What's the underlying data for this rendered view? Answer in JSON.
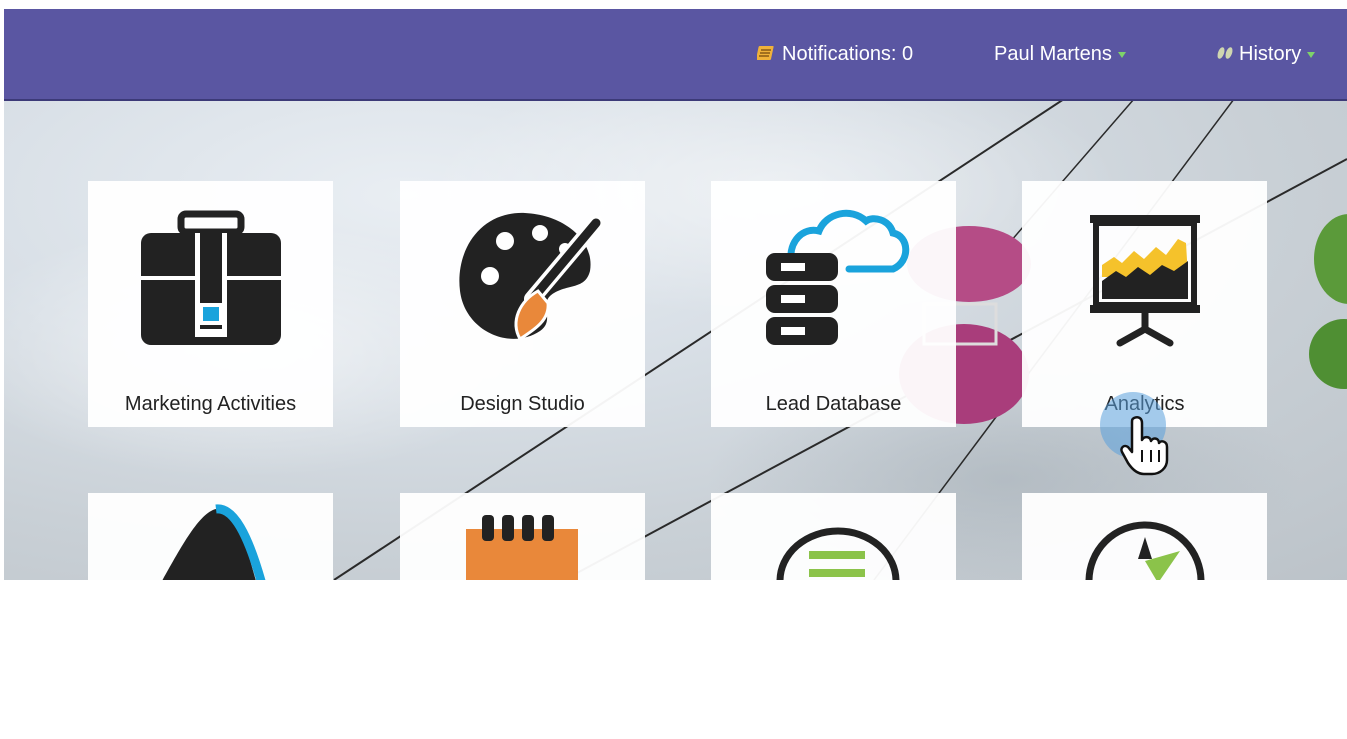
{
  "header": {
    "notifications_label": "Notifications: 0",
    "user_name": "Paul Martens",
    "history_label": "History"
  },
  "tiles": [
    {
      "label": "Marketing Activities",
      "icon": "briefcase-icon"
    },
    {
      "label": "Design Studio",
      "icon": "palette-icon"
    },
    {
      "label": "Lead Database",
      "icon": "database-cloud-icon"
    },
    {
      "label": "Analytics",
      "icon": "presentation-chart-icon"
    },
    {
      "label": "",
      "icon": "funnel-icon"
    },
    {
      "label": "",
      "icon": "calendar-icon"
    },
    {
      "label": "",
      "icon": "chat-bubble-icon"
    },
    {
      "label": "",
      "icon": "compass-icon"
    }
  ],
  "colors": {
    "header_bg": "#5a56a2",
    "accent_blue": "#1aa3dc",
    "accent_orange": "#e9883a",
    "accent_yellow": "#f5c22b",
    "accent_green": "#8bc34a"
  }
}
